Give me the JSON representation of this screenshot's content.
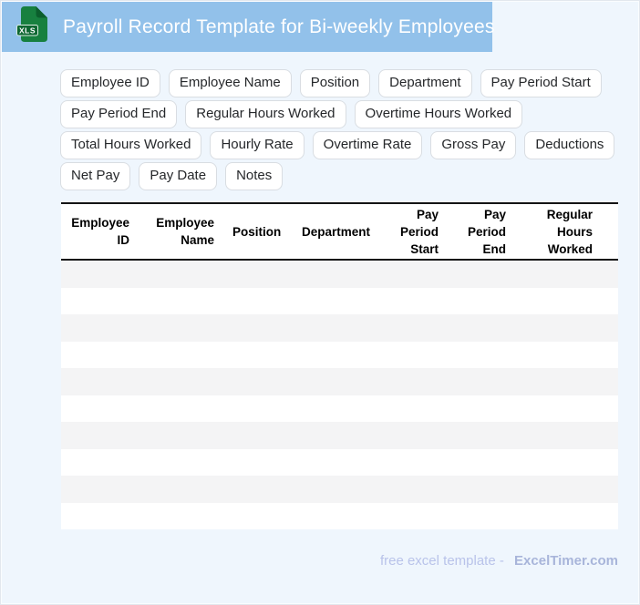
{
  "header": {
    "title": "Payroll Record Template for Bi-weekly Employees",
    "file_badge": "XLS"
  },
  "field_chips": [
    "Employee ID",
    "Employee Name",
    "Position",
    "Department",
    "Pay Period Start",
    "Pay Period End",
    "Regular Hours Worked",
    "Overtime Hours Worked",
    "Total Hours Worked",
    "Hourly Rate",
    "Overtime Rate",
    "Gross Pay",
    "Deductions",
    "Net Pay",
    "Pay Date",
    "Notes"
  ],
  "table": {
    "columns": [
      "Employee ID",
      "Employee Name",
      "Position",
      "Department",
      "Pay Period Start",
      "Pay Period End",
      "Regular Hours Worked"
    ],
    "empty_row_count": 10
  },
  "footer": {
    "caption": "free excel template -",
    "brand": "ExcelTimer.com"
  },
  "colors": {
    "banner": "#92c1ea",
    "page_bg": "#eff6fd",
    "stripe": "#f4f4f5",
    "header_border": "#141414",
    "icon_green": "#17803f",
    "icon_fold": "#0b5e2c",
    "footer_caption": "#b9c3ea",
    "footer_brand": "#a8b5da"
  }
}
